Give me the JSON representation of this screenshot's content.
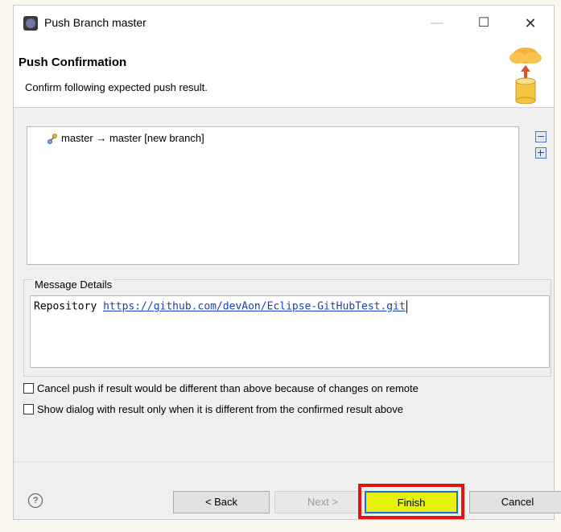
{
  "window": {
    "title": "Push Branch master",
    "minimize_symbol": "—",
    "maximize_symbol": "☐",
    "close_symbol": "✕"
  },
  "banner": {
    "title": "Push Confirmation",
    "description": "Confirm following expected push result.",
    "icon": "cloud-upload-database-icon"
  },
  "results": {
    "rows": [
      {
        "label": "master → master [new branch]",
        "icon": "branch-icon"
      }
    ],
    "tools": [
      "collapse-all-icon",
      "expand-all-icon"
    ]
  },
  "message_details": {
    "label": "Message Details",
    "prefix": "Repository ",
    "url": "https://github.com/devAon/Eclipse-GitHubTest.git"
  },
  "options": [
    {
      "label": "Cancel push if result would be different than above because of changes on remote",
      "checked": false
    },
    {
      "label": "Show dialog with result only when it is different from the confirmed result above",
      "checked": false
    }
  ],
  "buttons": {
    "help": "?",
    "back": "< Back",
    "next": "Next >",
    "finish": "Finish",
    "cancel": "Cancel"
  },
  "colors": {
    "finish_highlight_border": "#e31414",
    "finish_fill": "#e6f10c",
    "link": "#1a3fc4"
  }
}
